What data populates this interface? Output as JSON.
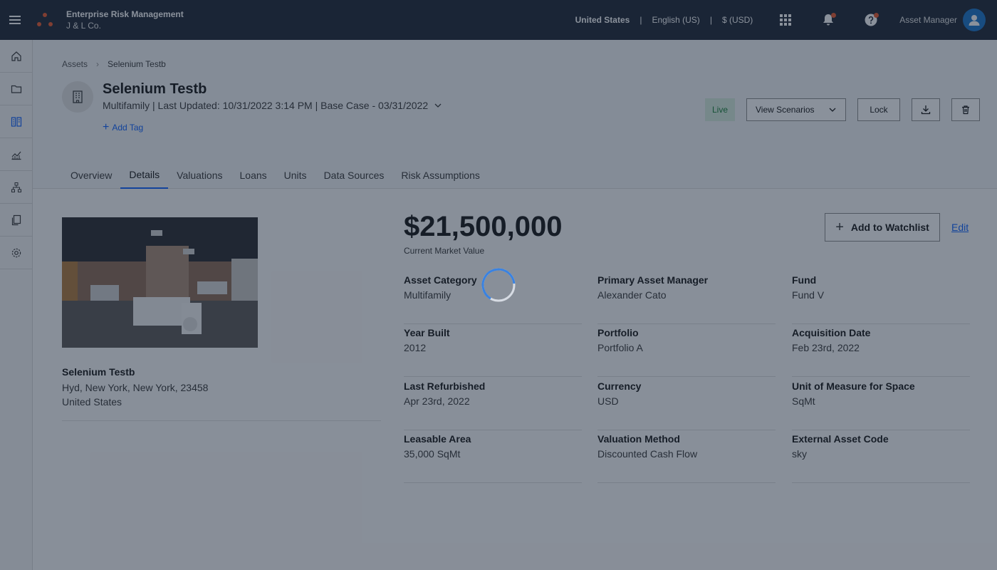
{
  "app": {
    "name": "Enterprise Risk Management",
    "company": "J & L Co.",
    "country": "United States",
    "language": "English (US)",
    "currency": "$ (USD)",
    "user_role": "Asset Manager",
    "icons": [
      "menu-icon",
      "apps-grid-icon",
      "notification-icon",
      "help-icon",
      "user-avatar-icon"
    ],
    "notification_dot_color": "#e8582c"
  },
  "rail": {
    "items": [
      "home-icon",
      "folder-icon",
      "assets-icon",
      "analytics-icon",
      "hierarchy-icon",
      "documents-icon",
      "settings-icon"
    ]
  },
  "breadcrumb": {
    "root": "Assets",
    "current": "Selenium Testb"
  },
  "asset": {
    "title": "Selenium Testb",
    "subtitle": "Multifamily | Last Updated: 10/31/2022 3:14 PM | Base Case - 03/31/2022",
    "add_tag": "Add Tag",
    "status": "Live"
  },
  "actions": {
    "view_scenarios": "View Scenarios",
    "lock": "Lock"
  },
  "tabs": [
    "Overview",
    "Details",
    "Valuations",
    "Loans",
    "Units",
    "Data Sources",
    "Risk Assumptions"
  ],
  "active_tab": "Details",
  "address": {
    "name": "Selenium Testb",
    "line1": "Hyd, New York, New York, 23458",
    "line2": "United States"
  },
  "market_value": {
    "amount": "$21,500,000",
    "label": "Current Market Value"
  },
  "watchlist_label": "Add to Watchlist",
  "edit_label": "Edit",
  "fields": [
    {
      "label": "Asset Category",
      "value": "Multifamily"
    },
    {
      "label": "Primary Asset Manager",
      "value": "Alexander Cato"
    },
    {
      "label": "Fund",
      "value": "Fund V"
    },
    {
      "label": "Year Built",
      "value": "2012"
    },
    {
      "label": "Portfolio",
      "value": "Portfolio A"
    },
    {
      "label": "Acquisition Date",
      "value": "Feb 23rd, 2022"
    },
    {
      "label": "Last Refurbished",
      "value": "Apr 23rd, 2022"
    },
    {
      "label": "Currency",
      "value": "USD"
    },
    {
      "label": "Unit of Measure for Space",
      "value": "SqMt"
    },
    {
      "label": "Leasable Area",
      "value": "35,000 SqMt"
    },
    {
      "label": "Valuation Method",
      "value": "Discounted Cash Flow"
    },
    {
      "label": "External Asset Code",
      "value": "sky"
    }
  ],
  "loading": true
}
